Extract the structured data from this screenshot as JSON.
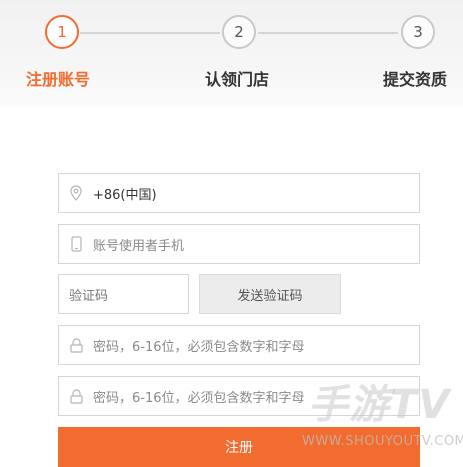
{
  "steps": [
    {
      "number": "1",
      "label": "注册账号",
      "active": true
    },
    {
      "number": "2",
      "label": "认领门店",
      "active": false
    },
    {
      "number": "3",
      "label": "提交资质",
      "active": false
    }
  ],
  "form": {
    "region_value": "+86(中国)",
    "phone_placeholder": "账号使用者手机",
    "code_placeholder": "验证码",
    "send_code_label": "发送验证码",
    "password_placeholder": "密码，6-16位，必须包含数字和字母",
    "confirm_password_placeholder": "密码，6-16位，必须包含数字和字母",
    "submit_label": "注册"
  },
  "watermark": {
    "title": "手游TV",
    "url": "WWW.SHOUYOUTV.COM"
  },
  "colors": {
    "accent": "#f26b2f",
    "border": "#d6d6d6"
  },
  "icons": {
    "region": "location-pin-icon",
    "phone": "mobile-phone-icon",
    "password": "lock-icon",
    "confirm_password": "lock-icon"
  }
}
